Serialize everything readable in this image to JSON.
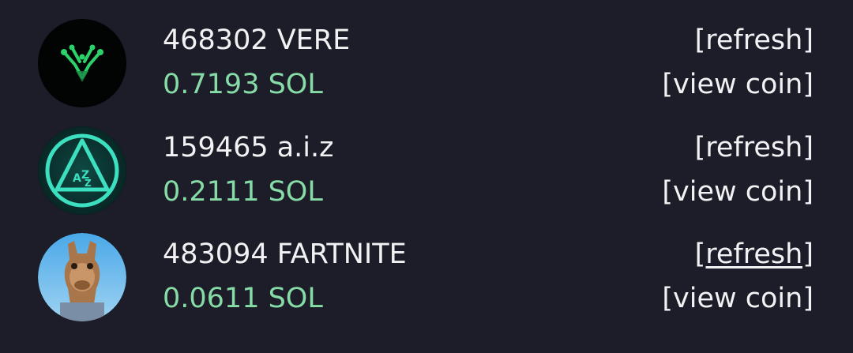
{
  "coins": [
    {
      "name": "468302 VERE",
      "amount": "0.7193 SOL",
      "refresh_label": "[refresh]",
      "view_label": "[view coin]",
      "avatar_icon": "green-v-logo-icon"
    },
    {
      "name": "159465 a.i.z",
      "amount": "0.2111 SOL",
      "refresh_label": "[refresh]",
      "view_label": "[view coin]",
      "avatar_icon": "aiz-triangle-logo-icon"
    },
    {
      "name": "483094 FARTNITE",
      "amount": "0.0611 SOL",
      "refresh_label": "[refresh]",
      "view_label": "[view coin]",
      "avatar_icon": "llama-character-icon"
    }
  ],
  "colors": {
    "background": "#1c1d28",
    "text": "#f2f2f4",
    "amount": "#86dba7",
    "accent_green": "#2bd16a",
    "accent_teal": "#3ce0c0"
  }
}
